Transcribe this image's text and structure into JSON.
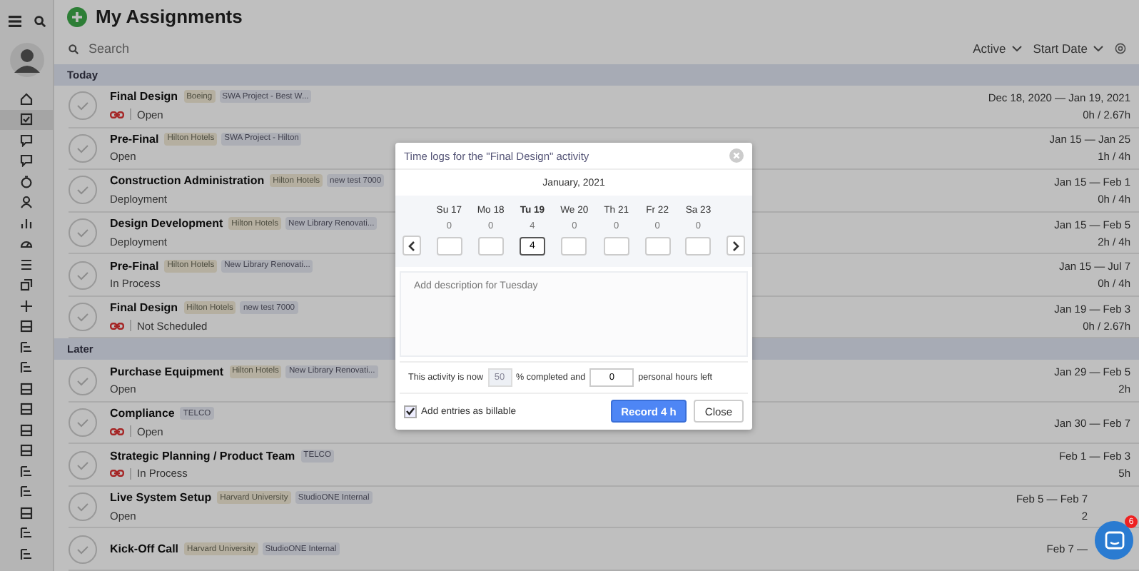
{
  "header": {
    "title": "My Assignments"
  },
  "search": {
    "placeholder": "Search"
  },
  "filters": [
    "Active",
    "Start Date"
  ],
  "groups": [
    {
      "label": "Today",
      "rows": [
        {
          "title": "Final Design",
          "done": false,
          "tags": [
            {
              "kind": "client",
              "text": "Boeing"
            },
            {
              "kind": "project",
              "text": "SWA Project - Best W..."
            }
          ],
          "linked": true,
          "status": "Open",
          "dates": "Dec 18, 2020 — Jan 19, 2021",
          "hours": "0h / 2.67h"
        },
        {
          "title": "Pre-Final",
          "done": false,
          "tags": [
            {
              "kind": "client",
              "text": "Hilton Hotels"
            },
            {
              "kind": "project",
              "text": "SWA Project - Hilton"
            }
          ],
          "linked": false,
          "status": "Open",
          "dates": "Jan 15 — Jan 25",
          "hours": "1h / 4h"
        },
        {
          "title": "Construction Administration",
          "done": false,
          "tags": [
            {
              "kind": "client",
              "text": "Hilton Hotels"
            },
            {
              "kind": "project",
              "text": "new test 7000"
            }
          ],
          "linked": false,
          "status": "Deployment",
          "dates": "Jan 15 — Feb 1",
          "hours": "0h / 4h"
        },
        {
          "title": "Design Development",
          "done": false,
          "tags": [
            {
              "kind": "client",
              "text": "Hilton Hotels"
            },
            {
              "kind": "project",
              "text": "New Library Renovati..."
            }
          ],
          "linked": false,
          "status": "Deployment",
          "dates": "Jan 15 — Feb 5",
          "hours": "2h / 4h"
        },
        {
          "title": "Pre-Final",
          "done": false,
          "tags": [
            {
              "kind": "client",
              "text": "Hilton Hotels"
            },
            {
              "kind": "project",
              "text": "New Library Renovati..."
            }
          ],
          "linked": false,
          "status": "In Process",
          "dates": "Jan 15 — Jul 7",
          "hours": "0h / 4h"
        },
        {
          "title": "Final Design",
          "done": false,
          "tags": [
            {
              "kind": "client",
              "text": "Hilton Hotels"
            },
            {
              "kind": "project",
              "text": "new test 7000"
            }
          ],
          "linked": true,
          "status": "Not Scheduled",
          "dates": "Jan 19 — Feb 3",
          "hours": "0h / 2.67h"
        }
      ]
    },
    {
      "label": "Later",
      "rows": [
        {
          "title": "Purchase Equipment",
          "done": false,
          "tags": [
            {
              "kind": "client",
              "text": "Hilton Hotels"
            },
            {
              "kind": "project",
              "text": "New Library Renovati..."
            }
          ],
          "linked": false,
          "status": "Open",
          "dates": "Jan 29 — Feb 5",
          "hours": "2h"
        },
        {
          "title": "Compliance",
          "done": false,
          "tags": [
            {
              "kind": "project",
              "text": "TELCO"
            }
          ],
          "linked": true,
          "status": "Open",
          "dates": "Jan 30 — Feb 7"
        },
        {
          "title": "Strategic Planning / Product Team",
          "done": false,
          "tags": [
            {
              "kind": "project",
              "text": "TELCO"
            }
          ],
          "linked": true,
          "status": "In Process",
          "dates": "Feb 1 — Feb 3",
          "hours": "5h"
        },
        {
          "title": "Live System Setup",
          "done": false,
          "tags": [
            {
              "kind": "client",
              "text": "Harvard University"
            },
            {
              "kind": "project",
              "text": "StudioONE Internal"
            }
          ],
          "linked": false,
          "status": "Open",
          "dates": "Feb 5 — Feb 7",
          "hours": "2"
        },
        {
          "title": "Kick-Off Call",
          "done": false,
          "tags": [
            {
              "kind": "client",
              "text": "Harvard University"
            },
            {
              "kind": "project",
              "text": "StudioONE Internal"
            }
          ],
          "dates": "Feb 7 —"
        }
      ]
    }
  ],
  "dialog": {
    "title": "Time logs for the \"Final Design\" activity",
    "month": "January, 2021",
    "days": [
      {
        "label": "Su 17",
        "logged": "0",
        "selected": false
      },
      {
        "label": "Mo 18",
        "logged": "0",
        "selected": false
      },
      {
        "label": "Tu 19",
        "logged": "4",
        "value": "4",
        "selected": true
      },
      {
        "label": "We 20",
        "logged": "0",
        "selected": false
      },
      {
        "label": "Th 21",
        "logged": "0",
        "selected": false
      },
      {
        "label": "Fr 22",
        "logged": "0",
        "selected": false
      },
      {
        "label": "Sa 23",
        "logged": "0",
        "selected": false
      }
    ],
    "description_placeholder": "Add description for Tuesday",
    "progress": {
      "before": "This activity is now",
      "percent": "50",
      "middle": "% completed and",
      "hours_left": "0",
      "after": "personal hours left"
    },
    "billable": {
      "label": "Add entries as billable",
      "checked": true
    },
    "record_button": "Record 4 h",
    "close_button": "Close"
  },
  "chat": {
    "badge": "6"
  }
}
